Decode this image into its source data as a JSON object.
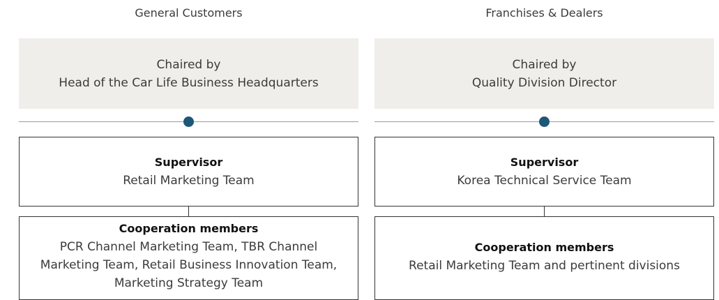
{
  "columns": [
    {
      "title": "General Customers",
      "chair_line1": "Chaired by",
      "chair_line2": "Head of the Car Life Business Headquarters",
      "supervisor_label": "Supervisor",
      "supervisor_value": "Retail Marketing Team",
      "cooperation_label": "Cooperation members",
      "cooperation_value": "PCR Channel Marketing Team, TBR Channel Marketing Team, Retail Business Innovation Team, Marketing Strategy Team"
    },
    {
      "title": "Franchises & Dealers",
      "chair_line1": "Chaired by",
      "chair_line2": "Quality Division Director",
      "supervisor_label": "Supervisor",
      "supervisor_value": "Korea Technical Service Team",
      "cooperation_label": "Cooperation members",
      "cooperation_value": "Retail Marketing Team and pertinent divisions"
    }
  ],
  "colors": {
    "chair_box_bg": "#efeeea",
    "dot": "#1c5777",
    "border": "#333333"
  }
}
